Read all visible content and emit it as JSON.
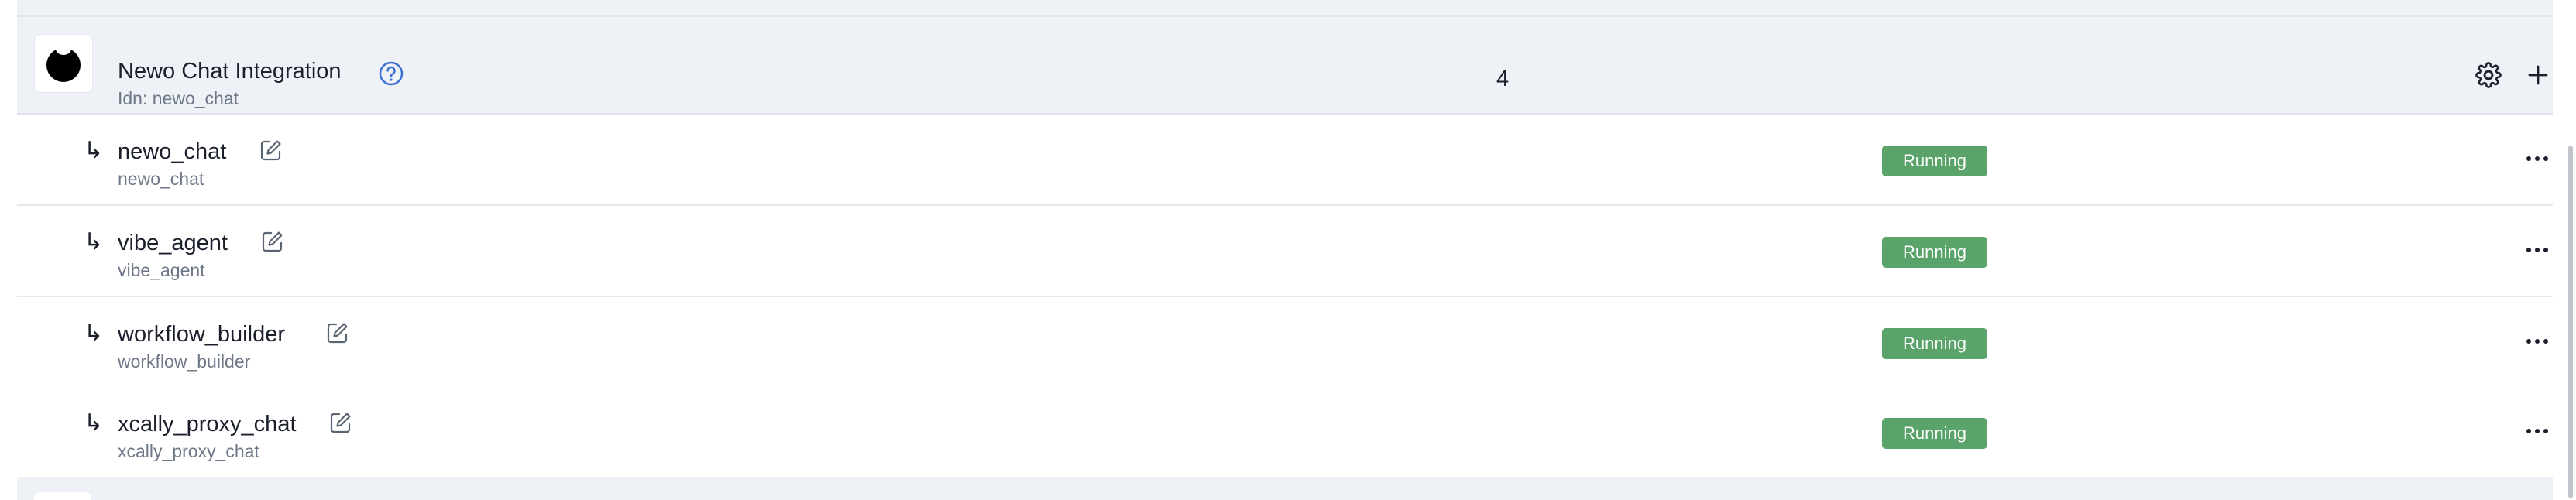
{
  "group": {
    "title": "Newo Chat Integration",
    "subtitle": "Idn: newo_chat",
    "count": "4"
  },
  "items": [
    {
      "title": "newo_chat",
      "subtitle": "newo_chat",
      "status": "Running"
    },
    {
      "title": "vibe_agent",
      "subtitle": "vibe_agent",
      "status": "Running"
    },
    {
      "title": "workflow_builder",
      "subtitle": "workflow_builder",
      "status": "Running"
    },
    {
      "title": "xcally_proxy_chat",
      "subtitle": "xcally_proxy_chat",
      "status": "Running"
    }
  ],
  "arrow_glyph": "↳",
  "icons": {
    "group_logo": "newo-logo-icon",
    "help": "help-circle-icon",
    "settings": "gear-icon",
    "add": "plus-icon",
    "edit": "edit-icon",
    "more": "more-horizontal-icon"
  },
  "colors": {
    "group_bg": "#eef1f6",
    "status_running": "#5aa36a",
    "help_icon": "#3b6fd4",
    "text_primary": "#1a1f2b",
    "text_secondary": "#6d7787"
  }
}
